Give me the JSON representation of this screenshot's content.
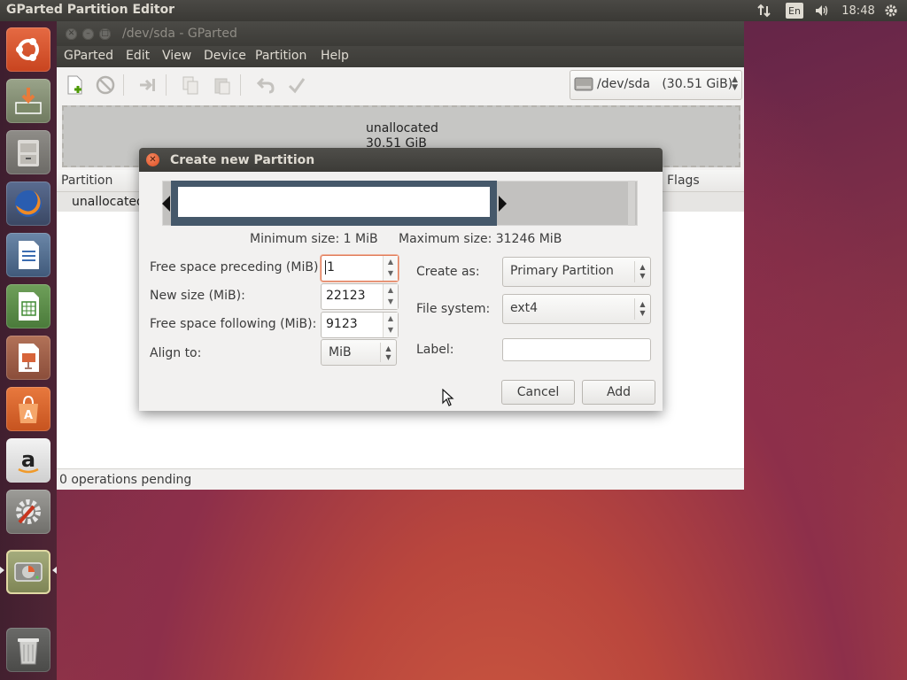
{
  "top_panel": {
    "title": "GParted Partition Editor",
    "keyboard_layout": "En",
    "time": "18:48"
  },
  "launcher": {
    "items": [
      {
        "name": "ubuntu-dash",
        "icon": "ubuntu-logo-icon"
      },
      {
        "name": "gparted-installer",
        "icon": "install-icon"
      },
      {
        "name": "files",
        "icon": "file-cabinet-icon"
      },
      {
        "name": "firefox",
        "icon": "firefox-icon"
      },
      {
        "name": "writer",
        "icon": "writer-document-icon"
      },
      {
        "name": "calc",
        "icon": "spreadsheet-icon"
      },
      {
        "name": "impress",
        "icon": "presentation-icon"
      },
      {
        "name": "software-center",
        "icon": "shopping-bag-icon"
      },
      {
        "name": "amazon",
        "icon": "amazon-icon"
      },
      {
        "name": "system-settings",
        "icon": "settings-icon"
      },
      {
        "name": "gparted",
        "icon": "disk-icon"
      },
      {
        "name": "trash",
        "icon": "trash-icon"
      }
    ]
  },
  "window": {
    "title": "/dev/sda - GParted",
    "menu": [
      "GParted",
      "Edit",
      "View",
      "Device",
      "Partition",
      "Help"
    ],
    "device": "/dev/sda",
    "device_size": "(30.51 GiB)",
    "disk_map": {
      "name": "unallocated",
      "size": "30.51 GiB"
    },
    "table": {
      "columns": [
        "Partition",
        "Flags"
      ],
      "row": "unallocated"
    },
    "status": "0 operations pending"
  },
  "dialog": {
    "title": "Create new Partition",
    "min_size": "Minimum size: 1 MiB",
    "max_size": "Maximum size: 31246 MiB",
    "free_preceding_label": "Free space preceding (MiB):",
    "free_preceding_value": "1",
    "new_size_label": "New size (MiB):",
    "new_size_value": "22123",
    "free_following_label": "Free space following (MiB):",
    "free_following_value": "9123",
    "align_label": "Align to:",
    "align_value": "MiB",
    "create_as_label": "Create as:",
    "create_as_value": "Primary Partition",
    "filesystem_label": "File system:",
    "filesystem_value": "ext4",
    "label_label": "Label:",
    "label_value": "",
    "cancel": "Cancel",
    "add": "Add"
  },
  "colors": {
    "panel": "#3c3b37",
    "partition_frame": "#45586a",
    "close_button": "#dd4d22"
  }
}
